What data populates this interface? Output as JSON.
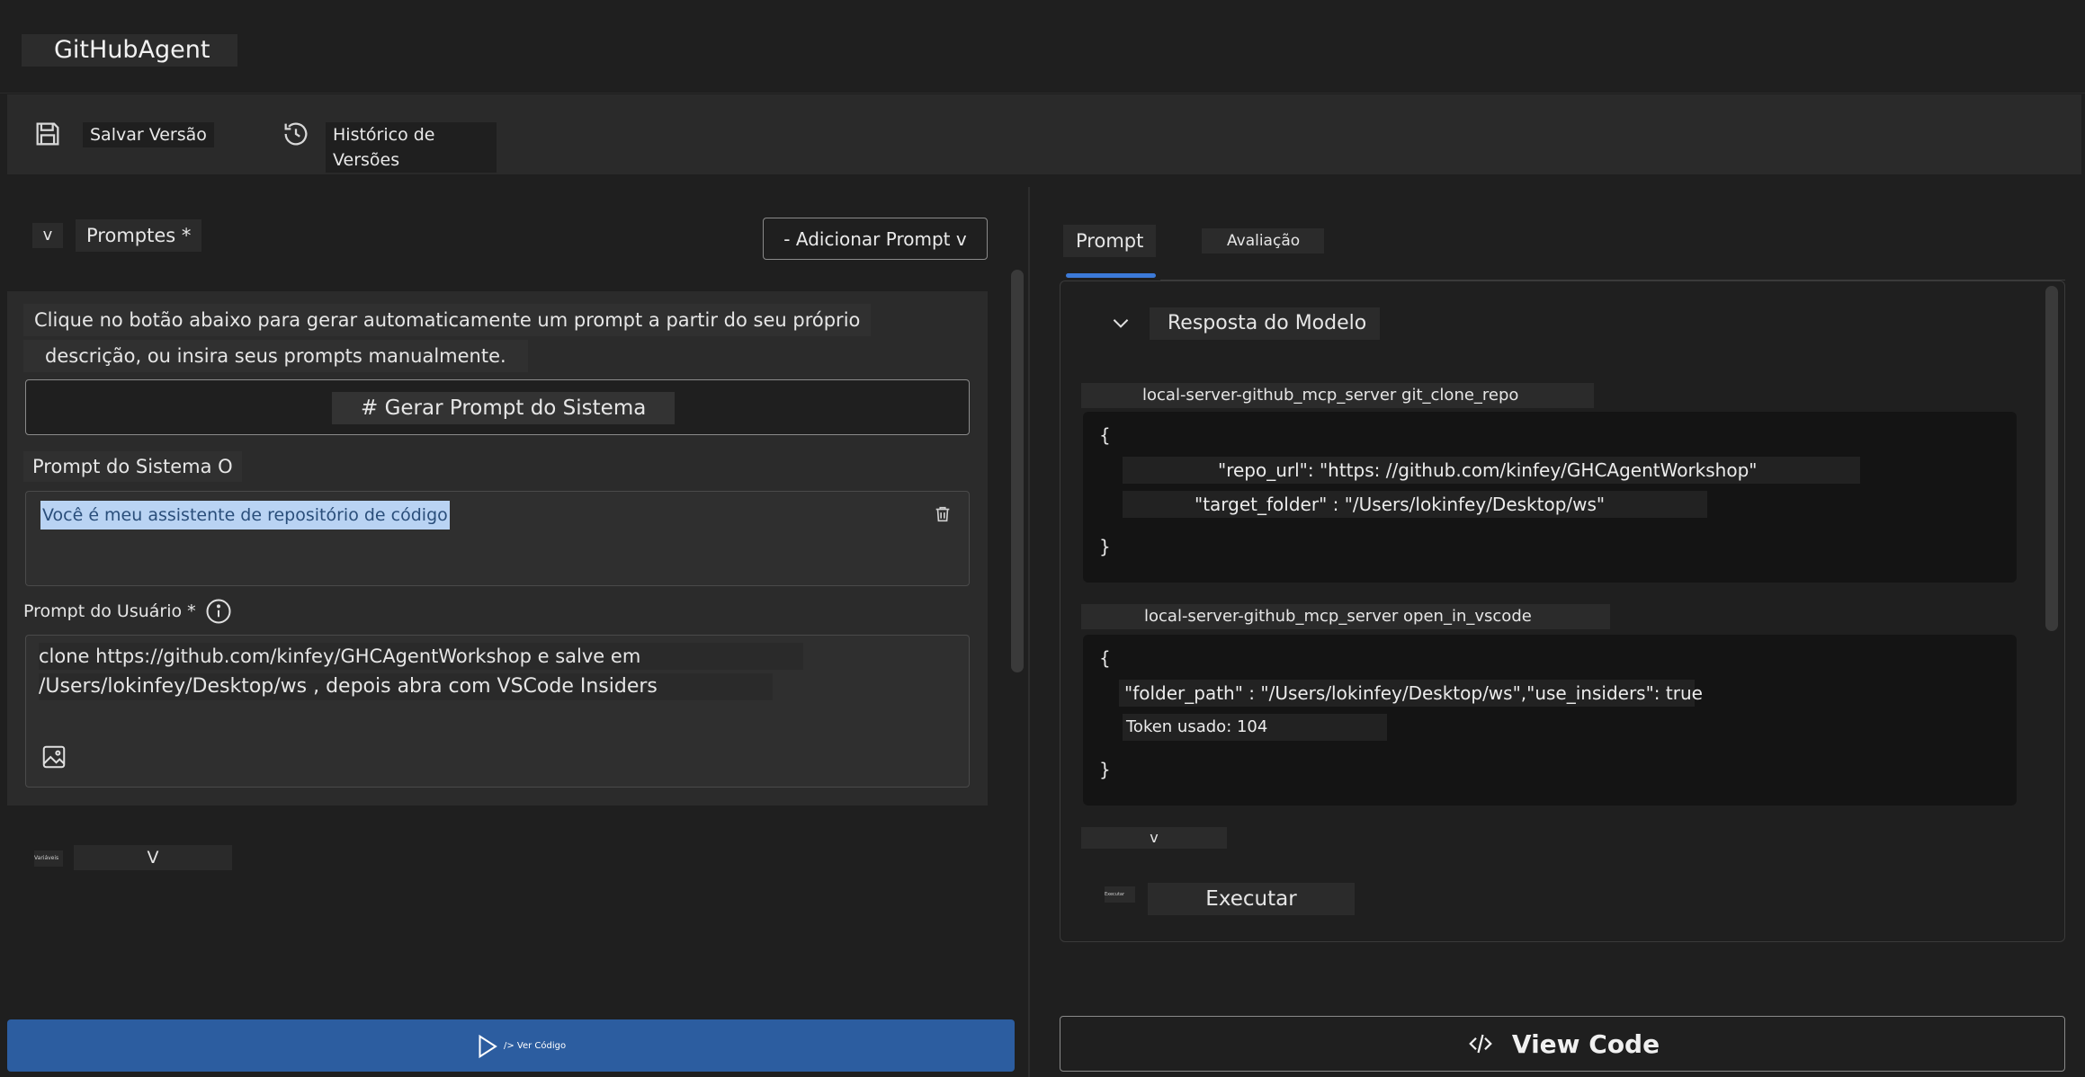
{
  "app": {
    "title": "GitHubAgent"
  },
  "toolbar": {
    "save_label": "Salvar Versão",
    "history_label": "Histórico de Versões"
  },
  "left": {
    "collapse_glyph": "v",
    "prompts_heading": "Promptes *",
    "add_prompt_label": "- Adicionar Prompt v",
    "intro_line1": "Clique no botão abaixo para gerar automaticamente um prompt a partir do seu próprio",
    "intro_line2": "descrição, ou insira seus prompts manualmente.",
    "generate_label": "# Gerar Prompt do Sistema",
    "system_prompt_label": "Prompt do Sistema O",
    "system_prompt_value": "Você é meu assistente de repositório de código",
    "user_prompt_label": "Prompt do Usuário *",
    "user_prompt_line1": "clone https://github.com/kinfey/GHCAgentWorkshop e salve em",
    "user_prompt_line2": "/Users/lokinfey/Desktop/ws , depois abra com VSCode Insiders",
    "variables_label": "Variáveis",
    "variables_glyph": "V",
    "run_label": "/> Ver Código"
  },
  "right": {
    "tabs": [
      {
        "label": "Prompt",
        "active": true
      },
      {
        "label": "Avaliação",
        "active": false
      }
    ],
    "section_title": "Resposta do Modelo",
    "tool_calls": [
      {
        "name": "local-server-github_mcp_server git_clone_repo",
        "open_brace": "{",
        "lines": [
          "\"repo_url\": \"https: //github.com/kinfey/GHCAgentWorkshop\"",
          "\"target_folder\" : \"/Users/lokinfey/Desktop/ws\""
        ],
        "close_brace": "}"
      },
      {
        "name": "local-server-github_mcp_server open_in_vscode",
        "open_brace": "{",
        "lines": [
          "\"folder_path\" : \"/Users/lokinfey/Desktop/ws\",\"use_insiders\": true",
          "Token usado: 104"
        ],
        "close_brace": "}"
      }
    ],
    "collapse_glyph": "v",
    "run_small_label": "Executar",
    "run_label": "Executar",
    "view_code_label": "View Code"
  },
  "colors": {
    "background": "#1f1f1f",
    "panel": "#2b2b2b",
    "accent": "#3c7ad8",
    "run_bar": "#2c5da0",
    "selection": "#b9d3f3"
  },
  "icons": [
    "save-icon",
    "history-icon",
    "trash-icon",
    "info-icon",
    "image-icon",
    "chevron-down-icon",
    "play-icon",
    "code-icon"
  ]
}
